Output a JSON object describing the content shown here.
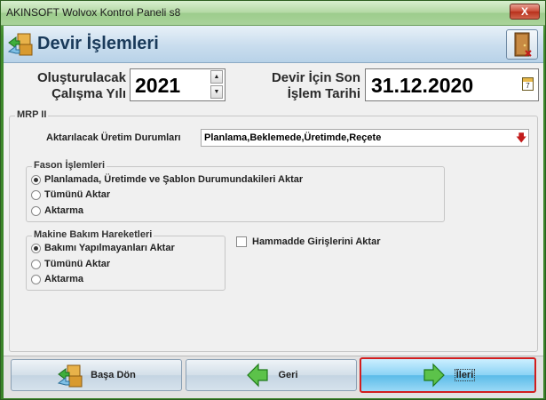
{
  "window": {
    "title": "AKINSOFT Wolvox Kontrol Paneli s8",
    "close": "X"
  },
  "header": {
    "title": "Devir İşlemleri"
  },
  "year": {
    "label_line1": "Oluşturulacak",
    "label_line2": "Çalışma Yılı",
    "value": "2021"
  },
  "date": {
    "label_line1": "Devir İçin Son",
    "label_line2": "İşlem Tarihi",
    "value": "31.12.2020",
    "calendar_day": "7"
  },
  "mrp": {
    "title": "MRP II",
    "production_label": "Aktarılacak Üretim Durumları",
    "production_value": "Planlama,Beklemede,Üretimde,Reçete"
  },
  "fason": {
    "title": "Fason İşlemleri",
    "options": [
      "Planlamada, Üretimde ve Şablon Durumundakileri Aktar",
      "Tümünü Aktar",
      "Aktarma"
    ],
    "selected_index": 0
  },
  "maintenance": {
    "title": "Makine Bakım Hareketleri",
    "options": [
      "Bakımı Yapılmayanları Aktar",
      "Tümünü Aktar",
      "Aktarma"
    ],
    "selected_index": 0
  },
  "raw_material": {
    "label": "Hammadde Girişlerini Aktar",
    "checked": false
  },
  "footer": {
    "home": "Başa Dön",
    "back": "Geri",
    "next": "İleri"
  },
  "colors": {
    "accent": "#5bbbe8",
    "highlight_border": "#d21e1e",
    "window_green": "#3f8a2c"
  }
}
